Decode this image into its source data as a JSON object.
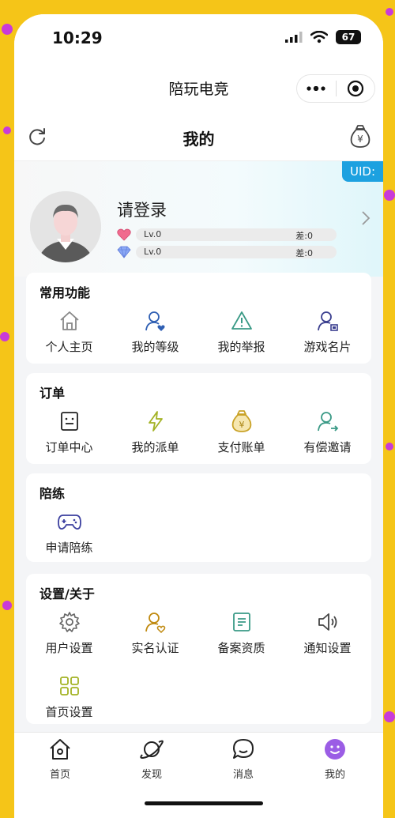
{
  "status_bar": {
    "time": "10:29",
    "battery": "67"
  },
  "nav": {
    "app_title": "陪玩电竞"
  },
  "header": {
    "title": "我的"
  },
  "profile": {
    "uid_label": "UID:",
    "login_prompt": "请登录",
    "levels": [
      {
        "level": "Lv.0",
        "diff": "差:0",
        "icon": "heart-icon"
      },
      {
        "level": "Lv.0",
        "diff": "差:0",
        "icon": "diamond-icon"
      }
    ]
  },
  "sections": {
    "common": {
      "title": "常用功能",
      "items": [
        "个人主页",
        "我的等级",
        "我的举报",
        "游戏名片"
      ]
    },
    "orders": {
      "title": "订单",
      "items": [
        "订单中心",
        "我的派单",
        "支付账单",
        "有偿邀请"
      ]
    },
    "training": {
      "title": "陪练",
      "items": [
        "申请陪练"
      ]
    },
    "settings": {
      "title": "设置/关于",
      "items": [
        "用户设置",
        "实名认证",
        "备案资质",
        "通知设置",
        "首页设置"
      ]
    }
  },
  "tabbar": {
    "items": [
      "首页",
      "发现",
      "消息",
      "我的"
    ]
  },
  "colors": {
    "accent_blue": "#1da1e0",
    "icon_gray": "#888888",
    "icon_blue": "#2f5fb3",
    "icon_green": "#3a9a86",
    "icon_gold": "#c9a227",
    "icon_olive": "#a3b224",
    "tab_active": "#9b5de5"
  }
}
